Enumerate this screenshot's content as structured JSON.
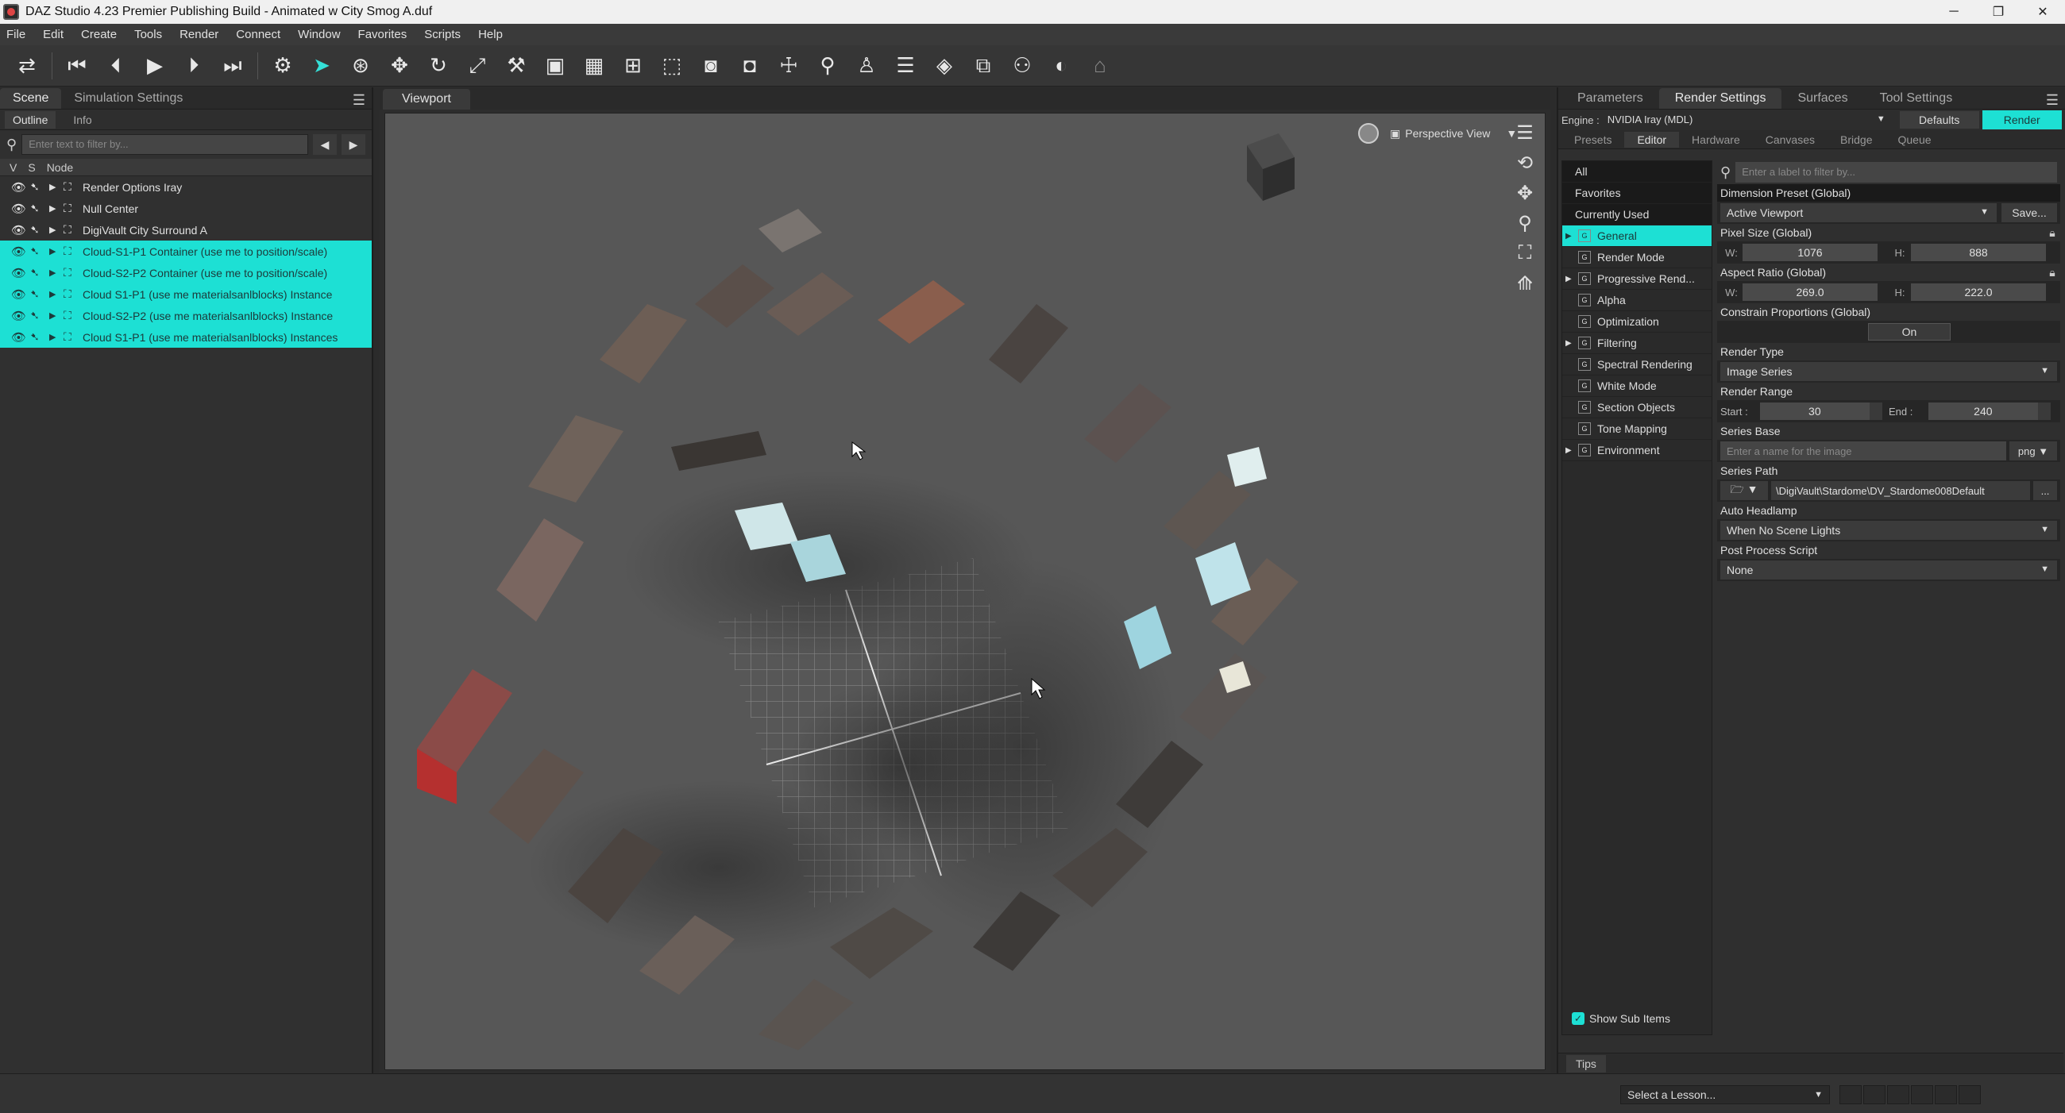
{
  "window": {
    "title": "DAZ Studio 4.23 Premier Publishing Build - Animated w City Smog A.duf"
  },
  "menu": [
    "File",
    "Edit",
    "Create",
    "Tools",
    "Render",
    "Connect",
    "Window",
    "Favorites",
    "Scripts",
    "Help"
  ],
  "left_pane": {
    "tabs": [
      "Scene",
      "Simulation Settings"
    ],
    "sub_tabs": [
      "Outline",
      "Info"
    ],
    "filter_placeholder": "Enter text to filter by...",
    "columns": [
      "V",
      "S",
      "Node"
    ],
    "nodes": [
      {
        "label": "Render Options Iray",
        "selected": false
      },
      {
        "label": "Null Center",
        "selected": false
      },
      {
        "label": "DigiVault City Surround A",
        "selected": false
      },
      {
        "label": "Cloud-S1-P1 Container (use me to position/scale)",
        "selected": true
      },
      {
        "label": "Cloud-S2-P2 Container (use me to position/scale)",
        "selected": true
      },
      {
        "label": "Cloud S1-P1 (use me materialsanlblocks) Instance",
        "selected": true
      },
      {
        "label": "Cloud-S2-P2 (use me materialsanlblocks) Instance",
        "selected": true
      },
      {
        "label": "Cloud S1-P1 (use me materialsanlblocks) Instances",
        "selected": true
      }
    ]
  },
  "viewport": {
    "tab": "Viewport",
    "view_mode": "Perspective View"
  },
  "right_pane": {
    "tabs": [
      "Parameters",
      "Render Settings",
      "Surfaces",
      "Tool Settings"
    ],
    "engine_label": "Engine :",
    "engine_value": "NVIDIA Iray (MDL)",
    "defaults_label": "Defaults",
    "render_label": "Render",
    "sub_tabs": [
      "Presets",
      "Editor",
      "Hardware",
      "Canvases",
      "Bridge",
      "Queue"
    ],
    "categories": [
      {
        "label": "All",
        "kind": "plain"
      },
      {
        "label": "Favorites",
        "kind": "plain"
      },
      {
        "label": "Currently Used",
        "kind": "plain"
      },
      {
        "label": "General",
        "kind": "sel",
        "expand": true
      },
      {
        "label": "Render Mode",
        "kind": "normal"
      },
      {
        "label": "Progressive Rend...",
        "kind": "normal",
        "expand": true
      },
      {
        "label": "Alpha",
        "kind": "normal"
      },
      {
        "label": "Optimization",
        "kind": "normal"
      },
      {
        "label": "Filtering",
        "kind": "normal",
        "expand": true
      },
      {
        "label": "Spectral Rendering",
        "kind": "normal"
      },
      {
        "label": "White Mode",
        "kind": "normal"
      },
      {
        "label": "Section Objects",
        "kind": "normal"
      },
      {
        "label": "Tone Mapping",
        "kind": "normal"
      },
      {
        "label": "Environment",
        "kind": "normal",
        "expand": true
      }
    ],
    "show_sub_items": "Show Sub Items",
    "label_filter_placeholder": "Enter a label to filter by...",
    "settings": {
      "dimension_preset_label": "Dimension Preset (Global)",
      "dimension_preset_value": "Active Viewport",
      "save_label": "Save...",
      "pixel_size_label": "Pixel Size (Global)",
      "pixel_w": "1076",
      "pixel_h": "888",
      "aspect_label": "Aspect Ratio (Global)",
      "aspect_w": "269.0",
      "aspect_h": "222.0",
      "w_label": "W:",
      "h_label": "H:",
      "constrain_label": "Constrain Proportions (Global)",
      "constrain_value": "On",
      "render_type_label": "Render Type",
      "render_type_value": "Image Series",
      "render_range_label": "Render Range",
      "start_label": "Start :",
      "start_value": "30",
      "end_label": "End :",
      "end_value": "240",
      "series_base_label": "Series Base",
      "series_base_placeholder": "Enter a name for the image",
      "series_ext": "png ▼",
      "series_path_label": "Series Path",
      "series_path_value": "\\DigiVault\\Stardome\\DV_Stardome008Default",
      "auto_headlamp_label": "Auto Headlamp",
      "auto_headlamp_value": "When No Scene Lights",
      "post_process_label": "Post Process Script",
      "post_process_value": "None"
    },
    "tips_label": "Tips"
  },
  "statusbar": {
    "lesson_placeholder": "Select a Lesson..."
  },
  "colors": {
    "accent": "#1de0d4",
    "panel": "#2f2f2f",
    "viewport_bg": "#575757"
  }
}
